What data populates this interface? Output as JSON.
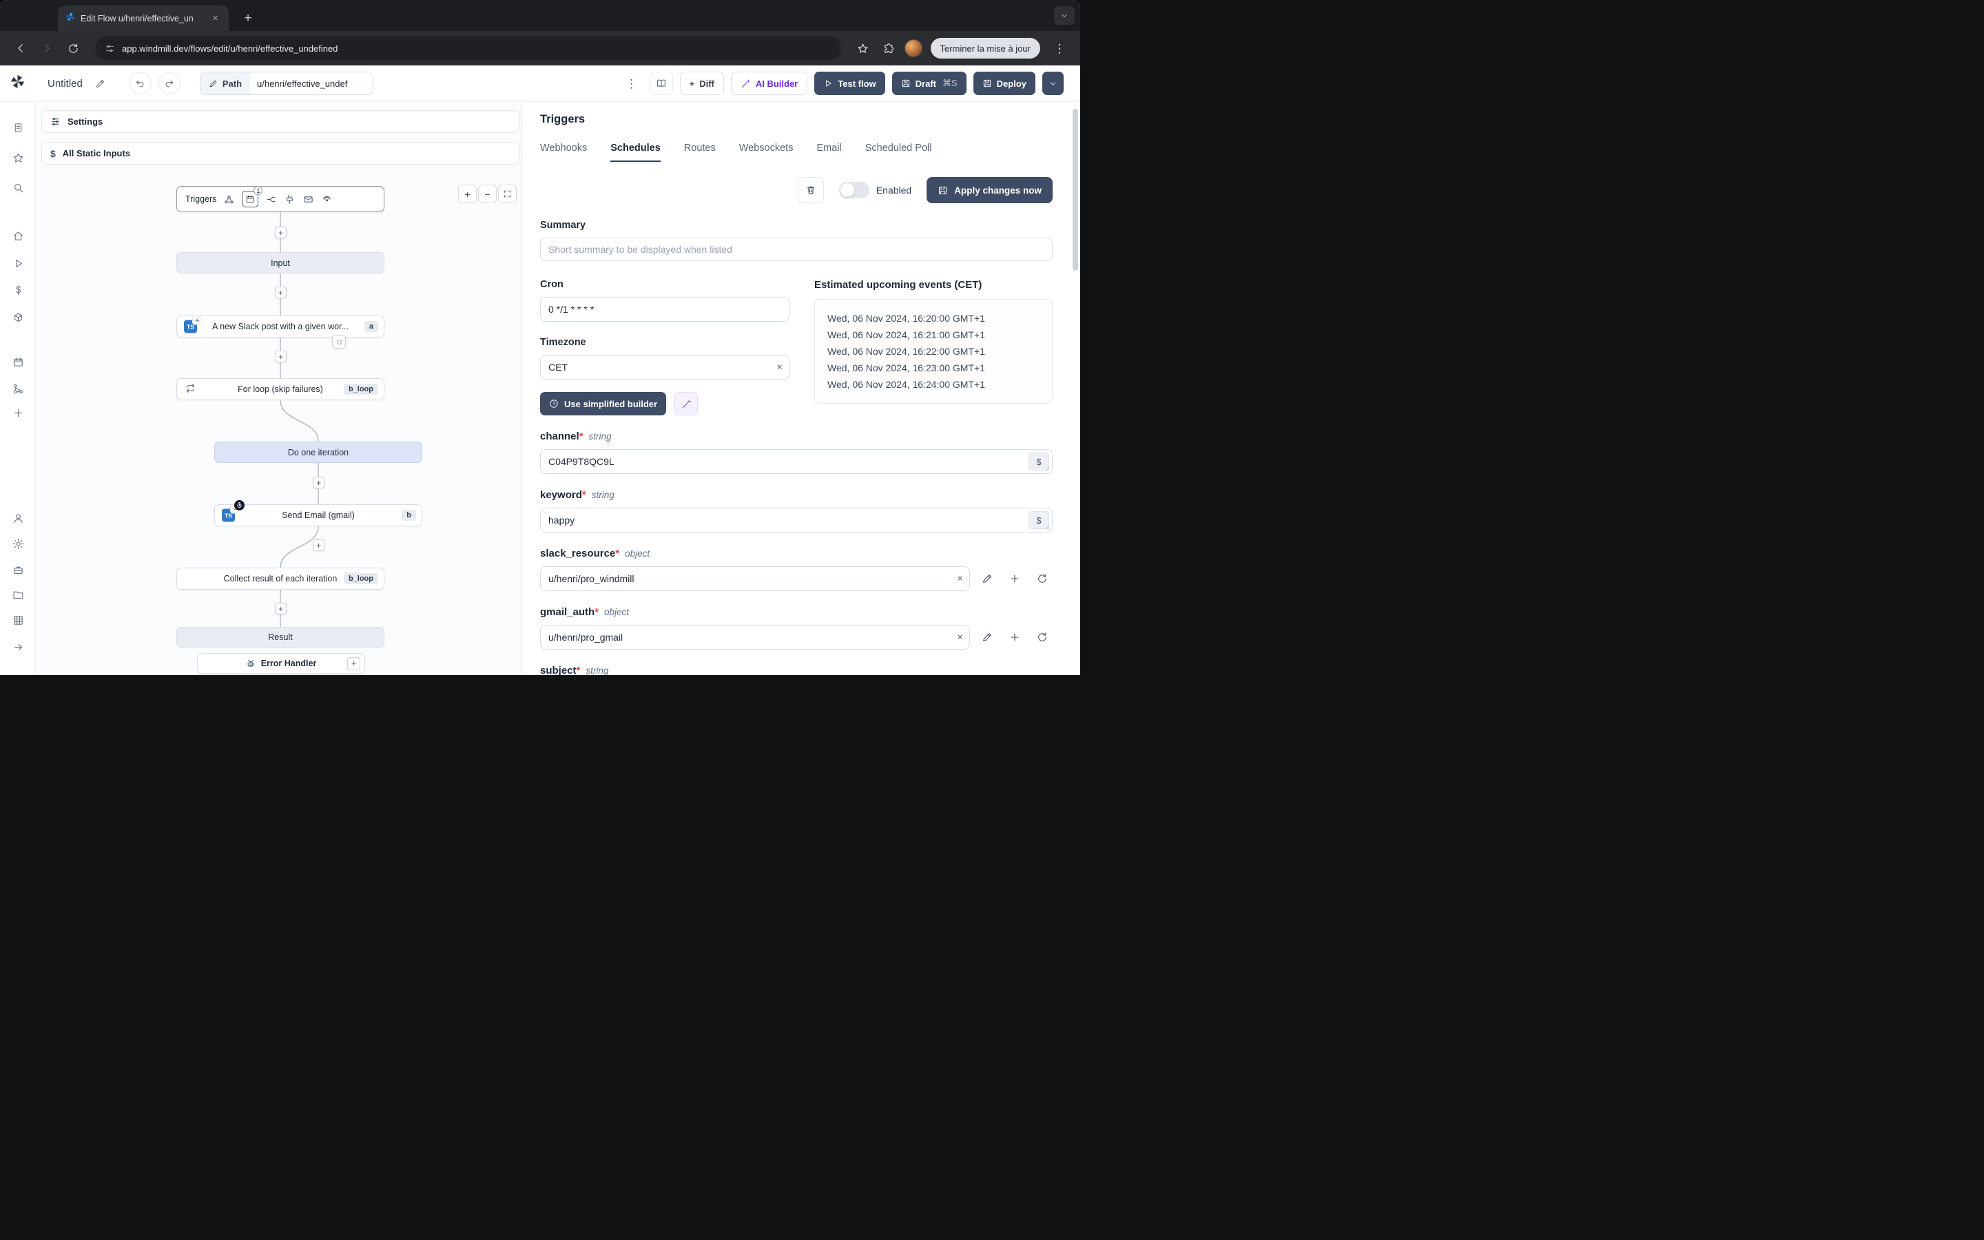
{
  "icons": {
    "plus": "+",
    "minus": "−",
    "close": "×",
    "kebab": "⋮",
    "dollar": "$"
  },
  "browser": {
    "tab_title": "Edit Flow u/henri/effective_un",
    "url": "app.windmill.dev/flows/edit/u/henri/effective_undefined",
    "update_button": "Terminer la mise à jour"
  },
  "header": {
    "title": "Untitled",
    "path_label": "Path",
    "path_value": "u/henri/effective_undef",
    "diff_label": "Diff",
    "ai_builder_label": "AI Builder",
    "test_flow_label": "Test flow",
    "draft_label": "Draft",
    "draft_shortcut": "⌘S",
    "deploy_label": "Deploy"
  },
  "flow": {
    "settings_label": "Settings",
    "static_inputs_label": "All Static Inputs",
    "triggers_node_label": "Triggers",
    "schedule_count": "1",
    "nodes": {
      "input": "Input",
      "slack": "A new Slack post with a given wor...",
      "slack_badge": "a",
      "forloop": "For loop (skip failures)",
      "forloop_badge": "b_loop",
      "iteration": "Do one iteration",
      "email": "Send Email (gmail)",
      "email_badge": "b",
      "collect": "Collect result of each iteration",
      "collect_badge": "b_loop",
      "result": "Result",
      "error_handler": "Error Handler"
    }
  },
  "panel": {
    "title": "Triggers",
    "tabs": [
      "Webhooks",
      "Schedules",
      "Routes",
      "Websockets",
      "Email",
      "Scheduled Poll"
    ],
    "enabled_label": "Enabled",
    "apply_label": "Apply changes now",
    "summary_label": "Summary",
    "summary_placeholder": "Short summary to be displayed when listed",
    "cron_label": "Cron",
    "cron_value": "0 */1 * * * *",
    "timezone_label": "Timezone",
    "timezone_value": "CET",
    "builder_label": "Use simplified builder",
    "events_title": "Estimated upcoming events (CET)",
    "events": [
      "Wed, 06 Nov 2024, 16:20:00 GMT+1",
      "Wed, 06 Nov 2024, 16:21:00 GMT+1",
      "Wed, 06 Nov 2024, 16:22:00 GMT+1",
      "Wed, 06 Nov 2024, 16:23:00 GMT+1",
      "Wed, 06 Nov 2024, 16:24:00 GMT+1"
    ],
    "required_mark": "*",
    "fields": {
      "channel": {
        "name": "channel",
        "type": "string",
        "value": "C04P9T8QC9L"
      },
      "keyword": {
        "name": "keyword",
        "type": "string",
        "value": "happy"
      },
      "slack_resource": {
        "name": "slack_resource",
        "type": "object",
        "value": "u/henri/pro_windmill"
      },
      "gmail_auth": {
        "name": "gmail_auth",
        "type": "object",
        "value": "u/henri/pro_gmail"
      },
      "subject": {
        "name": "subject",
        "type": "string"
      }
    }
  }
}
